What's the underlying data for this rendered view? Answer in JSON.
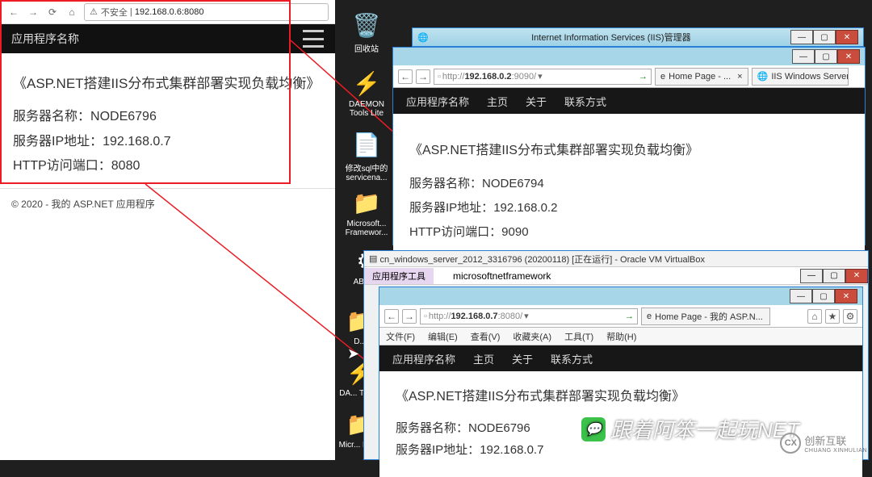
{
  "left_browser": {
    "insecure_label": "不安全",
    "url": "192.168.0.6:8080",
    "app_name": "应用程序名称",
    "article_title": "《ASP.NET搭建IIS分布式集群部署实现负载均衡》",
    "server_name_label": "服务器名称：",
    "server_name": "NODE6796",
    "server_ip_label": "服务器IP地址：",
    "server_ip": "192.168.0.7",
    "port_label": "HTTP访问端口：",
    "port": "8080",
    "footer": "© 2020 - 我的 ASP.NET 应用程序"
  },
  "desktop_icons": {
    "recycle": "回收站",
    "daemon": "DAEMON Tools Lite",
    "sql": "修改sql中的servicena...",
    "msfw": "Microsoft... Framewor...",
    "aben": "ABen...",
    "d": "D...",
    "da_tool": "DA... Tool...",
    "micr": "Micr... Fra..."
  },
  "iis_window": {
    "title": "Internet Information Services (IIS)管理器"
  },
  "browser2": {
    "url_prefix": "http://",
    "url_host": "192.168.0.2",
    "url_port": ":9090/",
    "tab1": "Home Page - ...",
    "tab2": "IIS Windows Server",
    "nav": {
      "app_name": "应用程序名称",
      "home": "主页",
      "about": "关于",
      "contact": "联系方式"
    },
    "article_title": "《ASP.NET搭建IIS分布式集群部署实现负载均衡》",
    "server_name_label": "服务器名称：",
    "server_name": "NODE6794",
    "server_ip_label": "服务器IP地址：",
    "server_ip": "192.168.0.2",
    "port_label": "HTTP访问端口：",
    "port": "9090"
  },
  "virtualbox": {
    "title": "cn_windows_server_2012_3316796 (20200118) [正在运行] - Oracle VM VirtualBox"
  },
  "explorer": {
    "tab": "应用程序工具",
    "title": "microsoftnetframework"
  },
  "browser3": {
    "url_prefix": "http://",
    "url_host": "192.168.0.7",
    "url_port": ":8080/",
    "tab1": "Home Page - 我的 ASP.N...",
    "menu": {
      "file": "文件(F)",
      "edit": "编辑(E)",
      "view": "查看(V)",
      "fav": "收藏夹(A)",
      "tools": "工具(T)",
      "help": "帮助(H)"
    },
    "nav": {
      "app_name": "应用程序名称",
      "home": "主页",
      "about": "关于",
      "contact": "联系方式"
    },
    "article_title": "《ASP.NET搭建IIS分布式集群部署实现负载均衡》",
    "server_name_label": "服务器名称：",
    "server_name": "NODE6796",
    "server_ip_label": "服务器IP地址：",
    "server_ip": "192.168.0.7"
  },
  "watermark": "跟着阿笨一起玩NET",
  "brand": "创新互联",
  "brand_en": "CHUANG XINHULIAN"
}
